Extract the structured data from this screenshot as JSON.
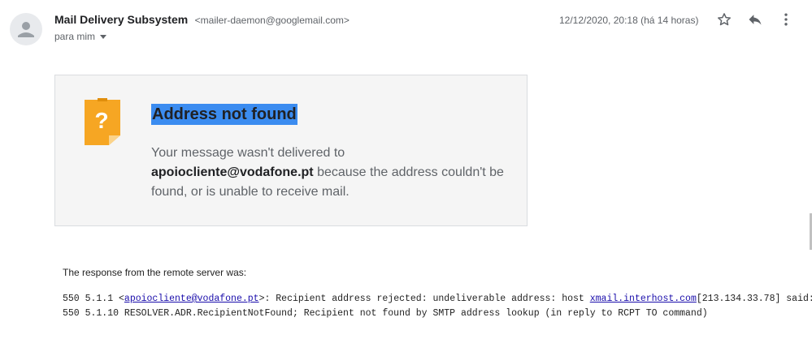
{
  "header": {
    "sender_name": "Mail Delivery Subsystem",
    "sender_email": "<mailer-daemon@googlemail.com>",
    "to_label": "para mim",
    "timestamp": "12/12/2020, 20:18 (há 14 horas)",
    "icons": [
      "star-icon",
      "reply-icon",
      "more-vert-icon"
    ]
  },
  "card": {
    "title": "Address not found",
    "body_prefix": "Your message wasn't delivered to ",
    "recipient": "apoiocliente@vodafone.pt",
    "body_suffix": " because the address couldn't be found, or is unable to receive mail.",
    "icon": "question-sticky-note-icon"
  },
  "response": {
    "label": "The response from the remote server was:",
    "line1_prefix": "550 5.1.1 <",
    "line1_email_link": "apoiocliente@vodafone.pt",
    "line1_middle": ">: Recipient address rejected: undeliverable address: host ",
    "line1_host_link": "xmail.interhost.com",
    "line1_suffix": "[213.134.33.78] said:",
    "line2": "550 5.1.10 RESOLVER.ADR.RecipientNotFound; Recipient not found by SMTP address lookup (in reply to RCPT TO command)"
  },
  "colors": {
    "title_highlight": "#3b8cf0",
    "icon_orange": "#f6a623",
    "link": "#1a0dab"
  }
}
